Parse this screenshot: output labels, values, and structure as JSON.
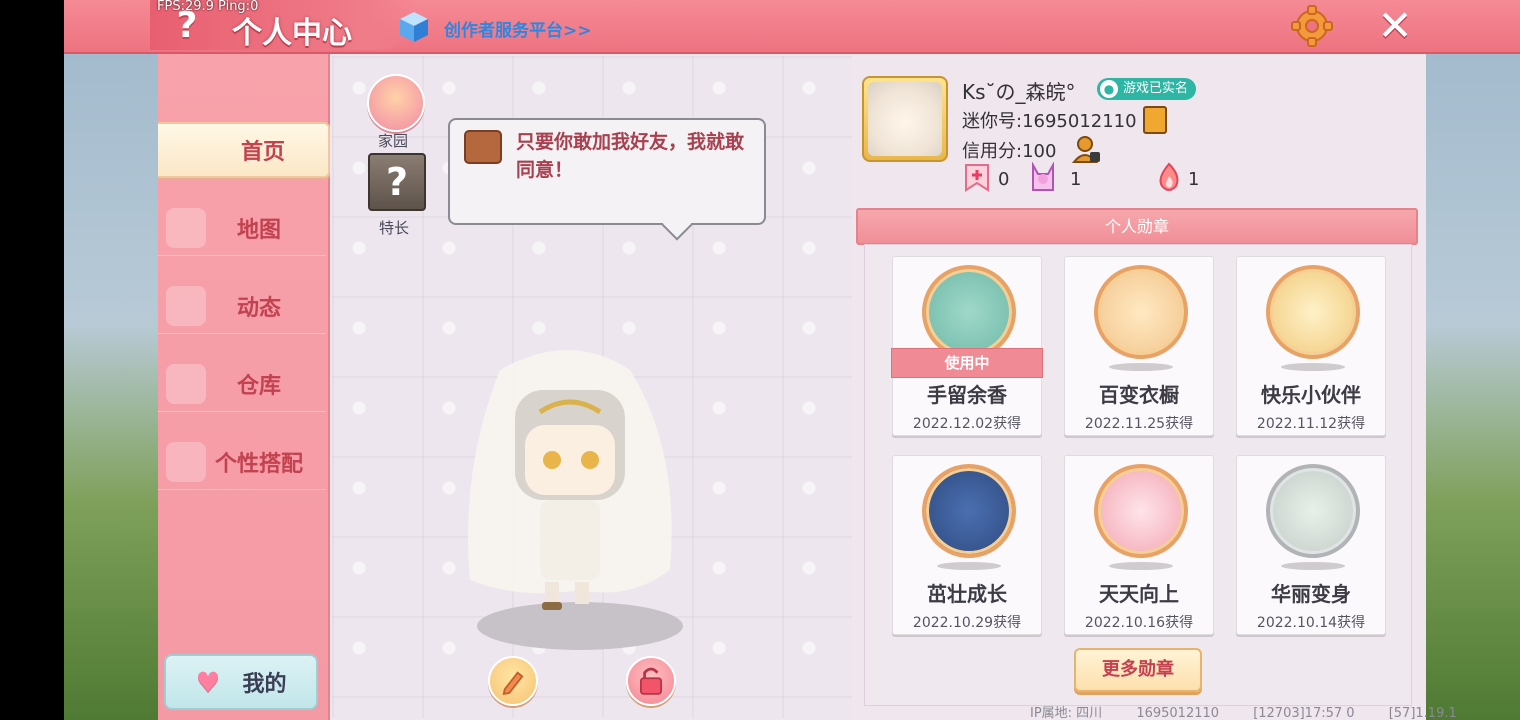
{
  "debug": {
    "fps": "FPS:29.9  Ping:0"
  },
  "header": {
    "title": "个人中心",
    "creator_link": "创作者服务平台>>",
    "settings_icon": "gear-icon",
    "close_icon": "close-icon"
  },
  "sidebar": {
    "items": [
      {
        "label": "首页",
        "active": true
      },
      {
        "label": "地图"
      },
      {
        "label": "动态"
      },
      {
        "label": "仓库"
      },
      {
        "label": "个性搭配"
      }
    ],
    "mine_label": "我的"
  },
  "left_panel": {
    "home_label": "家园",
    "skill_label": "特长",
    "bubble_text": "只要你敢加我好友，我就敢同意！"
  },
  "profile": {
    "nickname": "Ks˘の_森皖°",
    "verified": "游戏已实名",
    "mini_id": "迷你号:1695012110",
    "credit": "信用分:100",
    "stats": [
      "0",
      "1",
      "1"
    ]
  },
  "badges": {
    "header": "个人勋章",
    "using_label": "使用中",
    "items": [
      {
        "name": "手留余香",
        "date": "2022.12.02获得",
        "using": true
      },
      {
        "name": "百变衣橱",
        "date": "2022.11.25获得"
      },
      {
        "name": "快乐小伙伴",
        "date": "2022.11.12获得"
      },
      {
        "name": "茁壮成长",
        "date": "2022.10.29获得"
      },
      {
        "name": "天天向上",
        "date": "2022.10.16获得"
      },
      {
        "name": "华丽变身",
        "date": "2022.10.14获得"
      }
    ],
    "more": "更多勋章"
  },
  "footer": {
    "ip": "IP属地: 四川",
    "uid": "1695012110",
    "time": "[12703]17:57 0",
    "version": "[57]1.19.1"
  },
  "colors": {
    "accent": "#ee7381",
    "sidebar": "#f8a2ab",
    "creator_link": "#2f86e0"
  }
}
